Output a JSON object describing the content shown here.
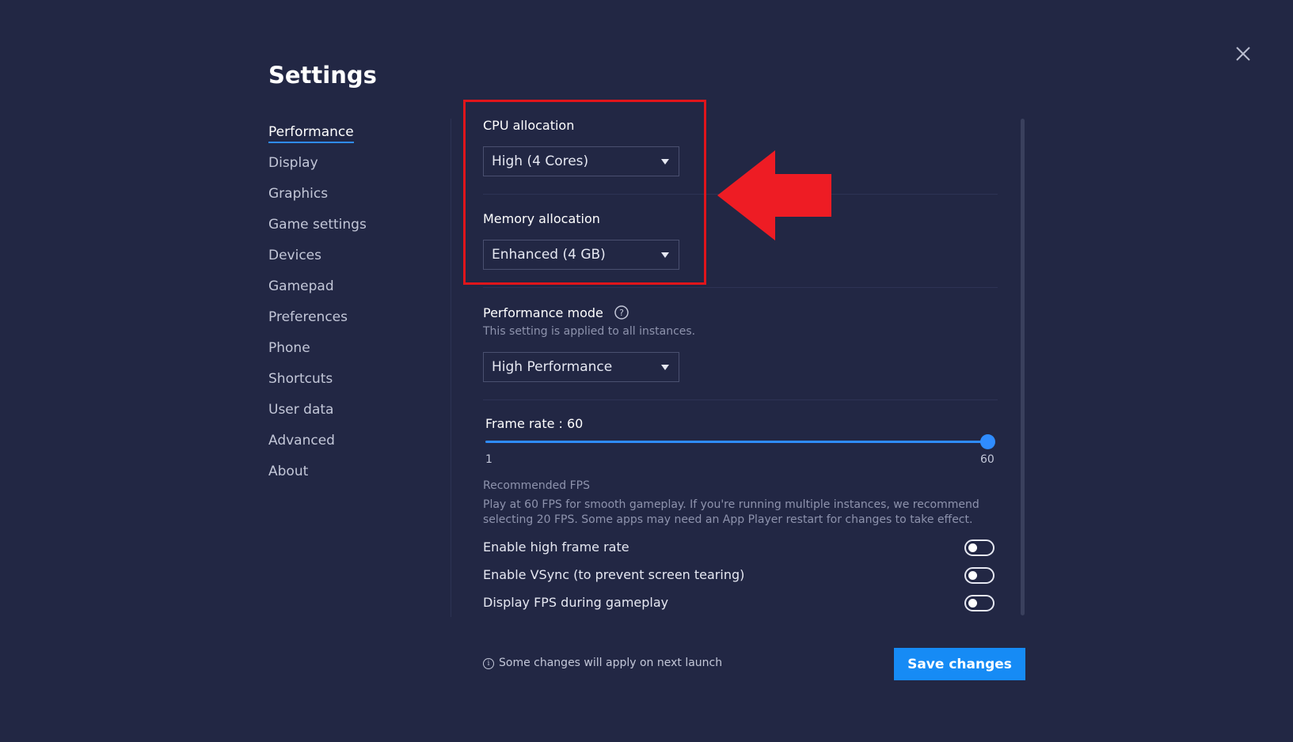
{
  "title": "Settings",
  "close_icon": "close-icon",
  "sidebar": {
    "items": [
      {
        "label": "Performance",
        "active": true
      },
      {
        "label": "Display"
      },
      {
        "label": "Graphics"
      },
      {
        "label": "Game settings"
      },
      {
        "label": "Devices"
      },
      {
        "label": "Gamepad"
      },
      {
        "label": "Preferences"
      },
      {
        "label": "Phone"
      },
      {
        "label": "Shortcuts"
      },
      {
        "label": "User data"
      },
      {
        "label": "Advanced"
      },
      {
        "label": "About"
      }
    ]
  },
  "performance": {
    "cpu": {
      "label": "CPU allocation",
      "value": "High (4 Cores)"
    },
    "memory": {
      "label": "Memory allocation",
      "value": "Enhanced (4 GB)"
    },
    "mode": {
      "label": "Performance mode",
      "help_icon": "help-icon",
      "hint": "This setting is applied to all instances.",
      "value": "High Performance"
    },
    "frame_rate": {
      "label": "Frame rate : 60",
      "value": 60,
      "min_label": "1",
      "max_label": "60"
    },
    "recommended": {
      "title": "Recommended FPS",
      "line1": "Play at 60 FPS for smooth gameplay. If you're running multiple instances, we recommend",
      "line2": "selecting 20 FPS. Some apps may need an App Player restart for changes to take effect."
    },
    "toggles": [
      {
        "label": "Enable high frame rate",
        "on": false
      },
      {
        "label": "Enable VSync (to prevent screen tearing)",
        "on": false
      },
      {
        "label": "Display FPS during gameplay",
        "on": false
      }
    ]
  },
  "footer": {
    "note": "Some changes will apply on next launch",
    "save_label": "Save changes"
  },
  "colors": {
    "background": "#222744",
    "accent": "#168bf5",
    "annotation": "#e0151b"
  }
}
